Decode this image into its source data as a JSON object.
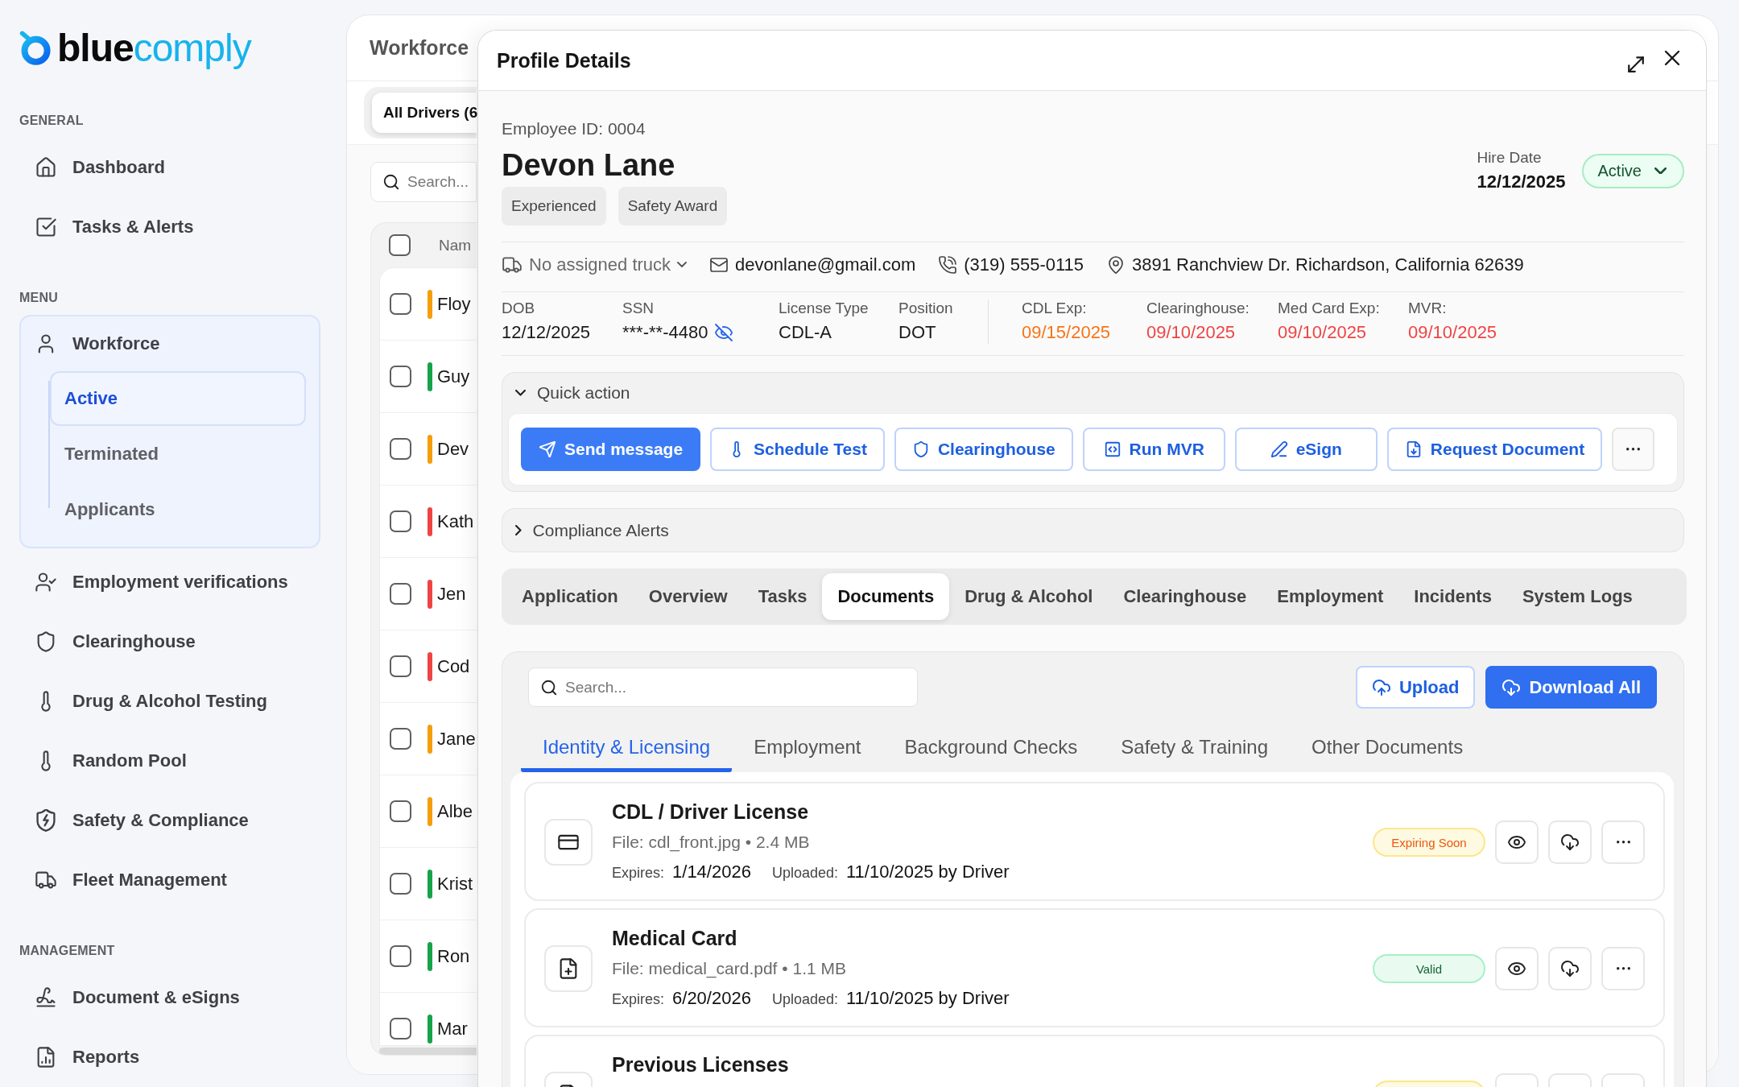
{
  "logo": {
    "bold_part": "blue",
    "light_part": "comply"
  },
  "sidebar": {
    "sections": [
      {
        "heading": "GENERAL",
        "items": [
          {
            "label": "Dashboard",
            "selected": false
          },
          {
            "label": "Tasks & Alerts",
            "selected": false
          }
        ]
      },
      {
        "heading": "MENU",
        "items": [
          {
            "label": "Workforce",
            "selected": false,
            "expanded": true,
            "children": [
              {
                "label": "Active",
                "selected": true
              },
              {
                "label": "Terminated",
                "selected": false
              },
              {
                "label": "Applicants",
                "selected": false
              }
            ]
          },
          {
            "label": "Employment verifications",
            "selected": false
          },
          {
            "label": "Clearinghouse",
            "selected": false
          },
          {
            "label": "Drug & Alcohol Testing",
            "selected": false
          },
          {
            "label": "Random Pool",
            "selected": false
          },
          {
            "label": "Safety & Compliance",
            "selected": false
          },
          {
            "label": "Fleet Management",
            "selected": false
          }
        ]
      },
      {
        "heading": "MANAGEMENT",
        "items": [
          {
            "label": "Document & eSigns",
            "selected": false
          },
          {
            "label": "Reports",
            "selected": false
          }
        ]
      }
    ]
  },
  "workforce_panel": {
    "title": "Workforce",
    "filter_tab": {
      "label": "All Drivers (6",
      "selected": true
    },
    "search": {
      "placeholder": "Search..."
    },
    "table": {
      "columns": [
        "Nam"
      ],
      "all_checked": false,
      "rows": [
        {
          "name": "Floy",
          "color": "#f59e0b",
          "checked": false
        },
        {
          "name": "Guy",
          "color": "#16a34a",
          "checked": false
        },
        {
          "name": "Dev",
          "color": "#f59e0b",
          "checked": false
        },
        {
          "name": "Kath",
          "color": "#ef4444",
          "checked": false
        },
        {
          "name": "Jen",
          "color": "#ef4444",
          "checked": false
        },
        {
          "name": "Cod",
          "color": "#ef4444",
          "checked": false
        },
        {
          "name": "Jane",
          "color": "#f59e0b",
          "checked": false
        },
        {
          "name": "Albe",
          "color": "#f59e0b",
          "checked": false
        },
        {
          "name": "Krist",
          "color": "#16a34a",
          "checked": false
        },
        {
          "name": "Ron",
          "color": "#16a34a",
          "checked": false
        },
        {
          "name": "Mar",
          "color": "#16a34a",
          "checked": false
        }
      ]
    }
  },
  "profile": {
    "title": "Profile Details",
    "employee_id": "Employee ID: 0004",
    "name": "Devon Lane",
    "tags": [
      "Experienced",
      "Safety Award"
    ],
    "hire_date": {
      "label": "Hire Date",
      "value": "12/12/2025"
    },
    "status": {
      "label": "Active"
    },
    "contacts": [
      {
        "kind": "truck_select",
        "text": "No assigned truck"
      },
      {
        "kind": "email",
        "text": "devonlane@gmail.com"
      },
      {
        "kind": "phone",
        "text": "(319) 555-0115"
      },
      {
        "kind": "address",
        "text": "3891 Ranchview Dr. Richardson, California 62639"
      }
    ],
    "details": [
      {
        "label": "DOB",
        "value": "12/12/2025"
      },
      {
        "label": "SSN",
        "value": "***-**-4480",
        "masked": true
      },
      {
        "label": "License Type",
        "value": "CDL-A"
      },
      {
        "label": "Position",
        "value": "DOT"
      }
    ],
    "expirations": [
      {
        "label": "CDL Exp:",
        "value": "09/15/2025",
        "color": "#f97316"
      },
      {
        "label": "Clearinghouse:",
        "value": "09/10/2025",
        "color": "#ef4444"
      },
      {
        "label": "Med Card Exp:",
        "value": "09/10/2025",
        "color": "#ef4444"
      },
      {
        "label": "MVR:",
        "value": "09/10/2025",
        "color": "#ef4444"
      }
    ],
    "quick_action": {
      "title": "Quick action",
      "expanded": true,
      "buttons": [
        {
          "label": "Send message",
          "primary": true
        },
        {
          "label": "Schedule Test",
          "primary": false
        },
        {
          "label": "Clearinghouse",
          "primary": false
        },
        {
          "label": "Run MVR",
          "primary": false
        },
        {
          "label": "eSign",
          "primary": false
        },
        {
          "label": "Request Document",
          "primary": false
        }
      ]
    },
    "compliance_alerts": {
      "title": "Compliance Alerts",
      "expanded": false
    },
    "tabs": [
      {
        "label": "Application",
        "selected": false
      },
      {
        "label": "Overview",
        "selected": false
      },
      {
        "label": "Tasks",
        "selected": false
      },
      {
        "label": "Documents",
        "selected": true
      },
      {
        "label": "Drug & Alcohol",
        "selected": false
      },
      {
        "label": "Clearinghouse",
        "selected": false
      },
      {
        "label": "Employment",
        "selected": false
      },
      {
        "label": "Incidents",
        "selected": false
      },
      {
        "label": "System Logs",
        "selected": false
      }
    ],
    "documents": {
      "search": {
        "placeholder": "Search..."
      },
      "buttons": [
        {
          "label": "Upload",
          "primary": false
        },
        {
          "label": "Download All",
          "primary": true
        }
      ],
      "categories": [
        {
          "label": "Identity & Licensing",
          "selected": true
        },
        {
          "label": "Employment",
          "selected": false
        },
        {
          "label": "Background Checks",
          "selected": false
        },
        {
          "label": "Safety & Training",
          "selected": false
        },
        {
          "label": "Other Documents",
          "selected": false
        }
      ],
      "items": [
        {
          "title": "CDL / Driver License",
          "file": "File: cdl_front.jpg • 2.4 MB",
          "expires_label": "Expires:",
          "expires": "1/14/2026",
          "uploaded_label": "Uploaded:",
          "uploaded": "11/10/2025 by Driver",
          "status": {
            "label": "Expiring Soon",
            "kind": "warning"
          }
        },
        {
          "title": "Medical Card",
          "file": "File: medical_card.pdf • 1.1 MB",
          "expires_label": "Expires:",
          "expires": "6/20/2026",
          "uploaded_label": "Uploaded:",
          "uploaded": "11/10/2025 by Driver",
          "status": {
            "label": "Valid",
            "kind": "valid"
          }
        },
        {
          "title": "Previous Licenses",
          "status": {
            "kind": "warning"
          }
        }
      ]
    }
  }
}
